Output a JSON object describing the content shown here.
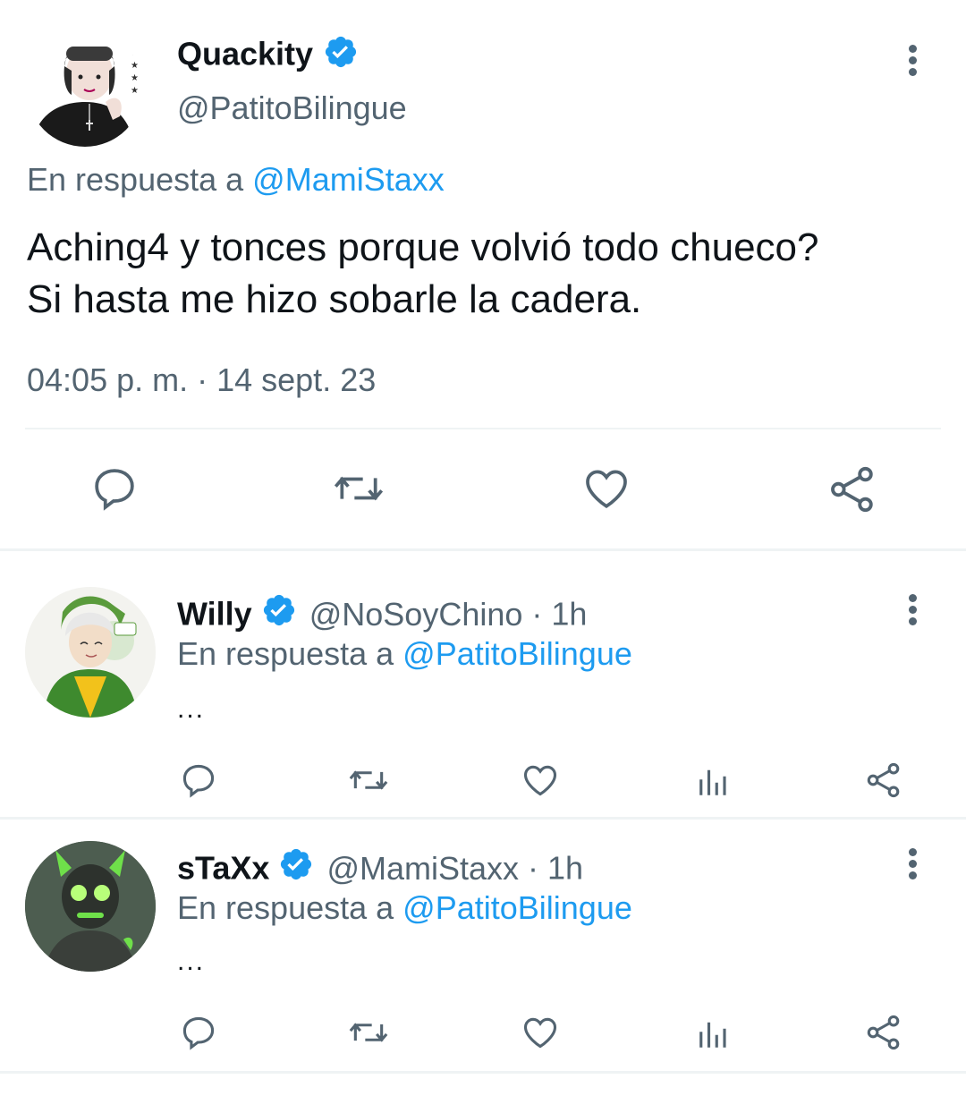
{
  "main_tweet": {
    "name": "Quackity",
    "handle": "@PatitoBilingue",
    "reply_prefix": "En respuesta a",
    "reply_to": "@MamiStaxx",
    "text_line1": "Aching4 y tonces porque volvió todo chueco?",
    "text_line2": "Si hasta me hizo sobarle la cadera.",
    "timestamp": "04:05 p. m. · 14 sept. 23"
  },
  "replies": [
    {
      "name": "Willy",
      "handle": "@NoSoyChino",
      "time": "· 1h",
      "reply_prefix": "En respuesta a",
      "reply_to": "@PatitoBilingue",
      "text": "..."
    },
    {
      "name": "sTaXx",
      "handle": "@MamiStaxx",
      "time": "· 1h",
      "reply_prefix": "En respuesta a",
      "reply_to": "@PatitoBilingue",
      "text": "..."
    }
  ],
  "colors": {
    "verified": "#1d9bf0",
    "link": "#1d9bf0",
    "muted": "#536471",
    "divider": "#eff3f4"
  },
  "icons": [
    "reply-icon",
    "retweet-icon",
    "like-icon",
    "analytics-icon",
    "share-icon",
    "more-icon",
    "verified-badge-icon"
  ]
}
